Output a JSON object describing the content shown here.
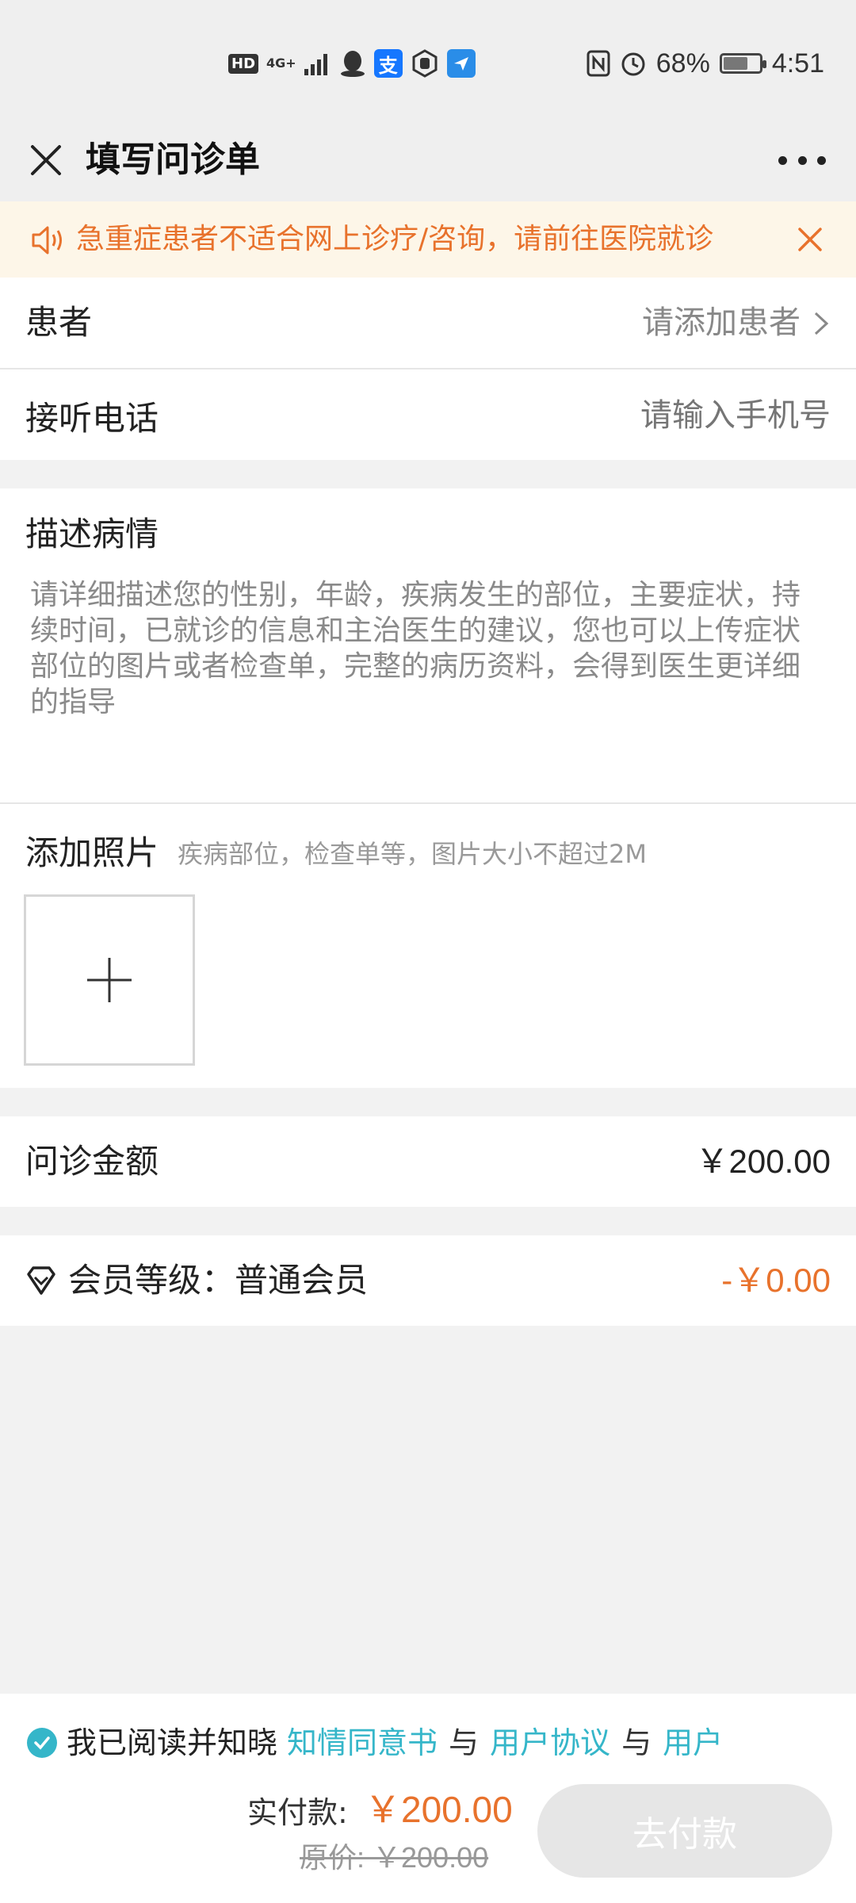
{
  "status_bar": {
    "hd_badge": "HD",
    "network": "4G+",
    "alipay_glyph": "支",
    "battery_percent": "68%",
    "battery_level": 0.68,
    "time": "4:51",
    "icons": [
      "signal-icon",
      "qq-icon",
      "alipay-icon",
      "hand-icon",
      "app-icon",
      "nfc-icon",
      "alarm-icon",
      "battery-icon"
    ]
  },
  "nav": {
    "title": "填写问诊单",
    "close_icon": "close-icon",
    "more_icon": "more-icon"
  },
  "notice": {
    "text": "急重症患者不适合网上诊疗/咨询，请前往医院就诊",
    "color": "#e8722c",
    "background": "#fdf6e8"
  },
  "patient": {
    "label": "患者",
    "placeholder": "请添加患者"
  },
  "phone": {
    "label": "接听电话",
    "placeholder": "请输入手机号"
  },
  "description": {
    "label": "描述病情",
    "placeholder": "请详细描述您的性别，年龄，疾病发生的部位，主要症状，持续时间，已就诊的信息和主治医生的建议，您也可以上传症状部位的图片或者检查单，完整的病历资料，会得到医生更详细的指导"
  },
  "photos": {
    "label": "添加照片",
    "hint": "疾病部位，检查单等，图片大小不超过2M"
  },
  "fee": {
    "label": "问诊金额",
    "value": "￥200.00"
  },
  "member": {
    "label": "会员等级：普通会员",
    "discount": "-￥0.00"
  },
  "footer": {
    "agree_prefix": "我已阅读并知晓",
    "link_consent": "知情同意书",
    "and": "与",
    "link_user_agreement": "用户协议",
    "link_user": "用户",
    "pay_label": "实付款:",
    "pay_value": "￥200.00",
    "original_price": "原价: ￥200.00",
    "pay_button": "去付款",
    "accent_color": "#35b6c9"
  }
}
